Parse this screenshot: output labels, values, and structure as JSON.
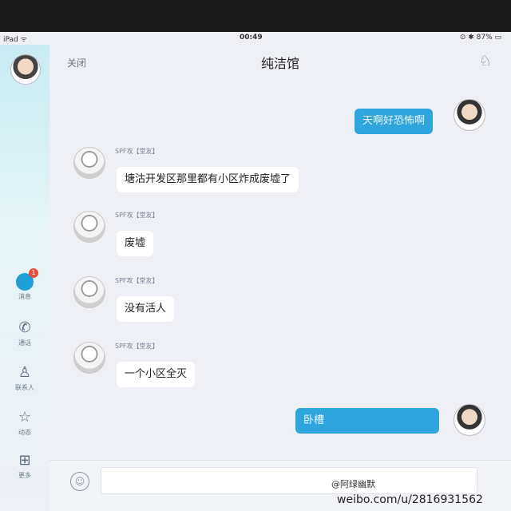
{
  "status_bar": {
    "carrier": "iPad ᯤ",
    "time": "00:49",
    "battery": "⊙ ✱ 87% ▭"
  },
  "header": {
    "close_label": "关闭",
    "title": "纯洁馆"
  },
  "sidebar": {
    "items": [
      {
        "label": "消息",
        "icon": "message-icon",
        "badge": "1"
      },
      {
        "label": "通话",
        "icon": "phone-icon"
      },
      {
        "label": "联系人",
        "icon": "contact-icon"
      },
      {
        "label": "动态",
        "icon": "star-icon"
      },
      {
        "label": "更多",
        "icon": "grid-icon"
      }
    ]
  },
  "messages": [
    {
      "sender": "me",
      "text": "天啊好恐怖啊"
    },
    {
      "sender": "peer",
      "nick": "SPF攻【堂友】",
      "text": "塘沽开发区那里都有小区炸成废墟了"
    },
    {
      "sender": "peer",
      "nick": "SPF攻【堂友】",
      "text": "废墟"
    },
    {
      "sender": "peer",
      "nick": "SPF攻【堂友】",
      "text": "没有活人"
    },
    {
      "sender": "peer",
      "nick": "SPF攻【堂友】",
      "text": "一个小区全灭"
    },
    {
      "sender": "me",
      "text": "卧槽"
    }
  ],
  "watermark": {
    "line1": "@阿绿幽默",
    "line2": "weibo.com/u/2816931562"
  },
  "colors": {
    "accent": "#2ea5dd",
    "sidebar_top": "#c8ecf2"
  }
}
